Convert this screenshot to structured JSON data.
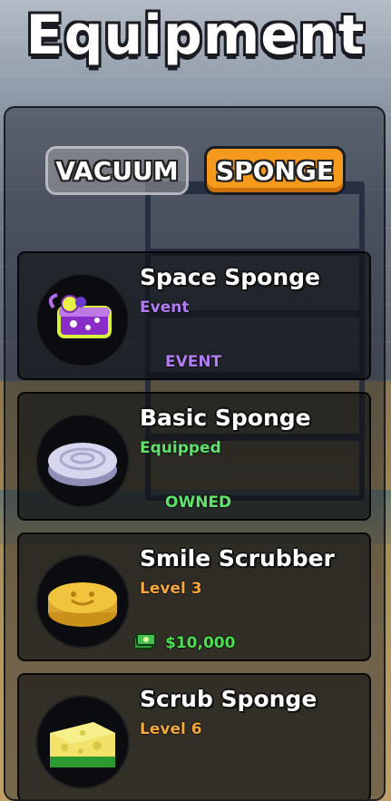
{
  "title": "Equipment",
  "tabs": [
    {
      "label": "VACUUM",
      "active": false
    },
    {
      "label": "SPONGE",
      "active": true
    }
  ],
  "items": [
    {
      "name": "Space Sponge",
      "subtitle": "Event",
      "action": "EVENT",
      "icon": "space-sponge-icon"
    },
    {
      "name": "Basic Sponge",
      "subtitle": "Equipped",
      "action": "OWNED",
      "icon": "basic-sponge-icon"
    },
    {
      "name": "Smile Scrubber",
      "subtitle": "Level 3",
      "action": "$10,000",
      "icon": "smile-scrubber-icon"
    },
    {
      "name": "Scrub Sponge",
      "subtitle": "Level 6",
      "action": "",
      "icon": "scrub-sponge-icon"
    }
  ],
  "colors": {
    "event_purple": "#b07cf2",
    "equipped_green": "#5fe36a",
    "level_orange": "#f3a83c",
    "price_green": "#47e24a",
    "active_tab": "#f59a1c"
  }
}
